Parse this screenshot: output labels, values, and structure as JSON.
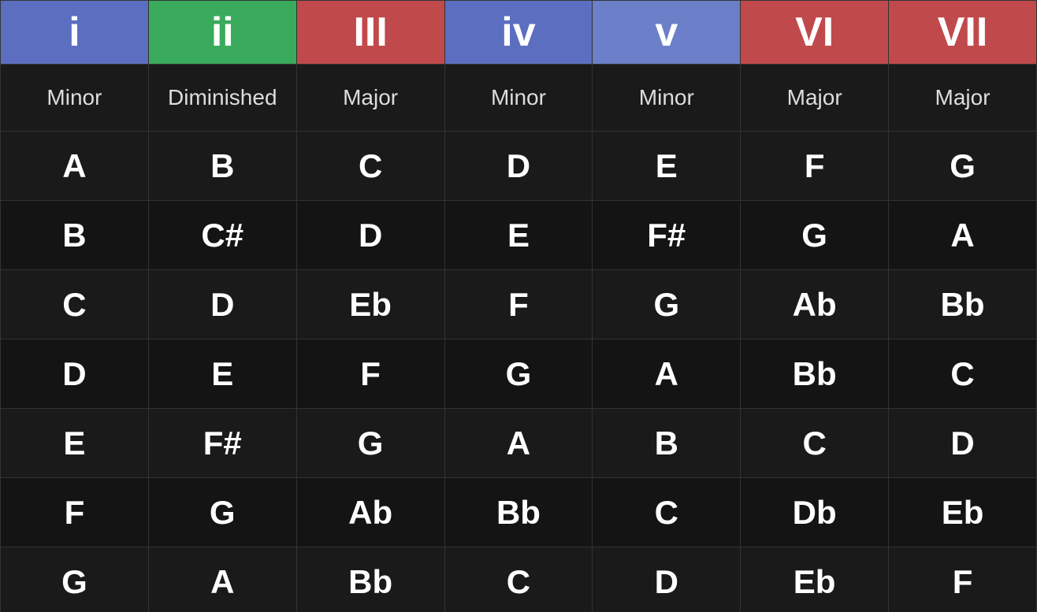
{
  "columns": [
    {
      "id": "i",
      "label": "i",
      "colorClass": "col-i",
      "quality": "Minor"
    },
    {
      "id": "ii",
      "label": "ii",
      "colorClass": "col-ii",
      "quality": "Diminished"
    },
    {
      "id": "iii",
      "label": "III",
      "colorClass": "col-iii",
      "quality": "Major"
    },
    {
      "id": "iv",
      "label": "iv",
      "colorClass": "col-iv",
      "quality": "Minor"
    },
    {
      "id": "v",
      "label": "v",
      "colorClass": "col-v",
      "quality": "Minor"
    },
    {
      "id": "vi",
      "label": "VI",
      "colorClass": "col-vi",
      "quality": "Major"
    },
    {
      "id": "vii",
      "label": "VII",
      "colorClass": "col-vii",
      "quality": "Major"
    }
  ],
  "rows": [
    [
      "A",
      "B",
      "C",
      "D",
      "E",
      "F",
      "G"
    ],
    [
      "B",
      "C#",
      "D",
      "E",
      "F#",
      "G",
      "A"
    ],
    [
      "C",
      "D",
      "Eb",
      "F",
      "G",
      "Ab",
      "Bb"
    ],
    [
      "D",
      "E",
      "F",
      "G",
      "A",
      "Bb",
      "C"
    ],
    [
      "E",
      "F#",
      "G",
      "A",
      "B",
      "C",
      "D"
    ],
    [
      "F",
      "G",
      "Ab",
      "Bb",
      "C",
      "Db",
      "Eb"
    ],
    [
      "G",
      "A",
      "Bb",
      "C",
      "D",
      "Eb",
      "F"
    ]
  ]
}
